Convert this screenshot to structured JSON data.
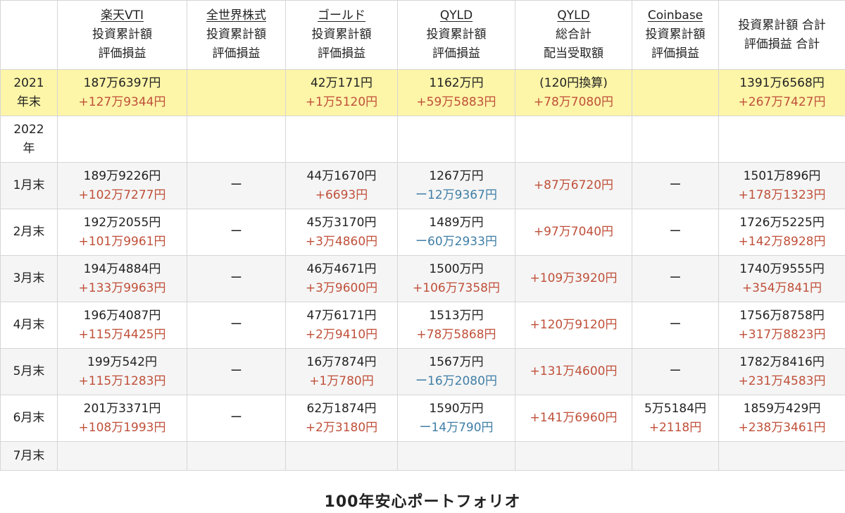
{
  "headers": [
    {
      "lines": [
        "",
        "",
        ""
      ]
    },
    {
      "lines": [
        "楽天VTI",
        "投資累計額",
        "評価損益"
      ]
    },
    {
      "lines": [
        "全世界株式",
        "投資累計額",
        "評価損益"
      ]
    },
    {
      "lines": [
        "ゴールド",
        "投資累計額",
        "評価損益"
      ]
    },
    {
      "lines": [
        "QYLD",
        "投資累計額",
        "評価損益"
      ]
    },
    {
      "lines": [
        "QYLD",
        "総合計",
        "配当受取額"
      ]
    },
    {
      "lines": [
        "Coinbase",
        "投資累計額",
        "評価損益"
      ]
    },
    {
      "lines": [
        "投資累計額 合計",
        "評価損益 合計",
        ""
      ]
    }
  ],
  "row2021": {
    "label": [
      "2021",
      "年末"
    ],
    "cells": [
      [
        "187万6397円",
        "+127万9344円"
      ],
      [
        "",
        ""
      ],
      [
        "42万171円",
        "+1万5120円"
      ],
      [
        "1162万円",
        "+59万5883円"
      ],
      [
        "(120円換算)",
        "+78万7080円"
      ],
      [
        "",
        ""
      ],
      [
        "1391万6568円",
        "+267万7427円"
      ]
    ]
  },
  "row2022": {
    "label": [
      "2022",
      "年"
    ]
  },
  "months": [
    {
      "label": "1月末",
      "cells": [
        [
          "189万9226円",
          "+102万7277円"
        ],
        [
          "ー",
          ""
        ],
        [
          "44万1670円",
          "+6693円"
        ],
        [
          "1267万円",
          "ー12万9367円"
        ],
        [
          "+87万6720円",
          ""
        ],
        [
          "ー",
          ""
        ],
        [
          "1501万896円",
          "+178万1323円"
        ]
      ]
    },
    {
      "label": "2月末",
      "cells": [
        [
          "192万2055円",
          "+101万9961円"
        ],
        [
          "ー",
          ""
        ],
        [
          "45万3170円",
          "+3万4860円"
        ],
        [
          "1489万円",
          "ー60万2933円"
        ],
        [
          "+97万7040円",
          ""
        ],
        [
          "ー",
          ""
        ],
        [
          "1726万5225円",
          "+142万8928円"
        ]
      ]
    },
    {
      "label": "3月末",
      "cells": [
        [
          "194万4884円",
          "+133万9963円"
        ],
        [
          "ー",
          ""
        ],
        [
          "46万4671円",
          "+3万9600円"
        ],
        [
          "1500万円",
          "+106万7358円"
        ],
        [
          "+109万3920円",
          ""
        ],
        [
          "ー",
          ""
        ],
        [
          "1740万9555円",
          "+354万841円"
        ]
      ]
    },
    {
      "label": "4月末",
      "cells": [
        [
          "196万4087円",
          "+115万4425円"
        ],
        [
          "ー",
          ""
        ],
        [
          "47万6171円",
          "+2万9410円"
        ],
        [
          "1513万円",
          "+78万5868円"
        ],
        [
          "+120万9120円",
          ""
        ],
        [
          "ー",
          ""
        ],
        [
          "1756万8758円",
          "+317万8823円"
        ]
      ]
    },
    {
      "label": "5月末",
      "cells": [
        [
          "199万542円",
          "+115万1283円"
        ],
        [
          "ー",
          ""
        ],
        [
          "16万7874円",
          "+1万780円"
        ],
        [
          "1567万円",
          "ー16万2080円"
        ],
        [
          "+131万4600円",
          ""
        ],
        [
          "ー",
          ""
        ],
        [
          "1782万8416円",
          "+231万4583円"
        ]
      ]
    },
    {
      "label": "6月末",
      "cells": [
        [
          "201万3371円",
          "+108万1993円"
        ],
        [
          "ー",
          ""
        ],
        [
          "62万1874円",
          "+2万3180円"
        ],
        [
          "1590万円",
          "ー14万790円"
        ],
        [
          "+141万6960円",
          ""
        ],
        [
          "5万5184円",
          "+2118円"
        ],
        [
          "1859万429円",
          "+238万3461円"
        ]
      ]
    }
  ],
  "row7": {
    "label": "7月末"
  },
  "caption": "100年安心ポートフォリオ",
  "colors": {
    "positive": "#c0503a",
    "negative": "#3f7ea6",
    "highlight": "#fdf5a8"
  }
}
